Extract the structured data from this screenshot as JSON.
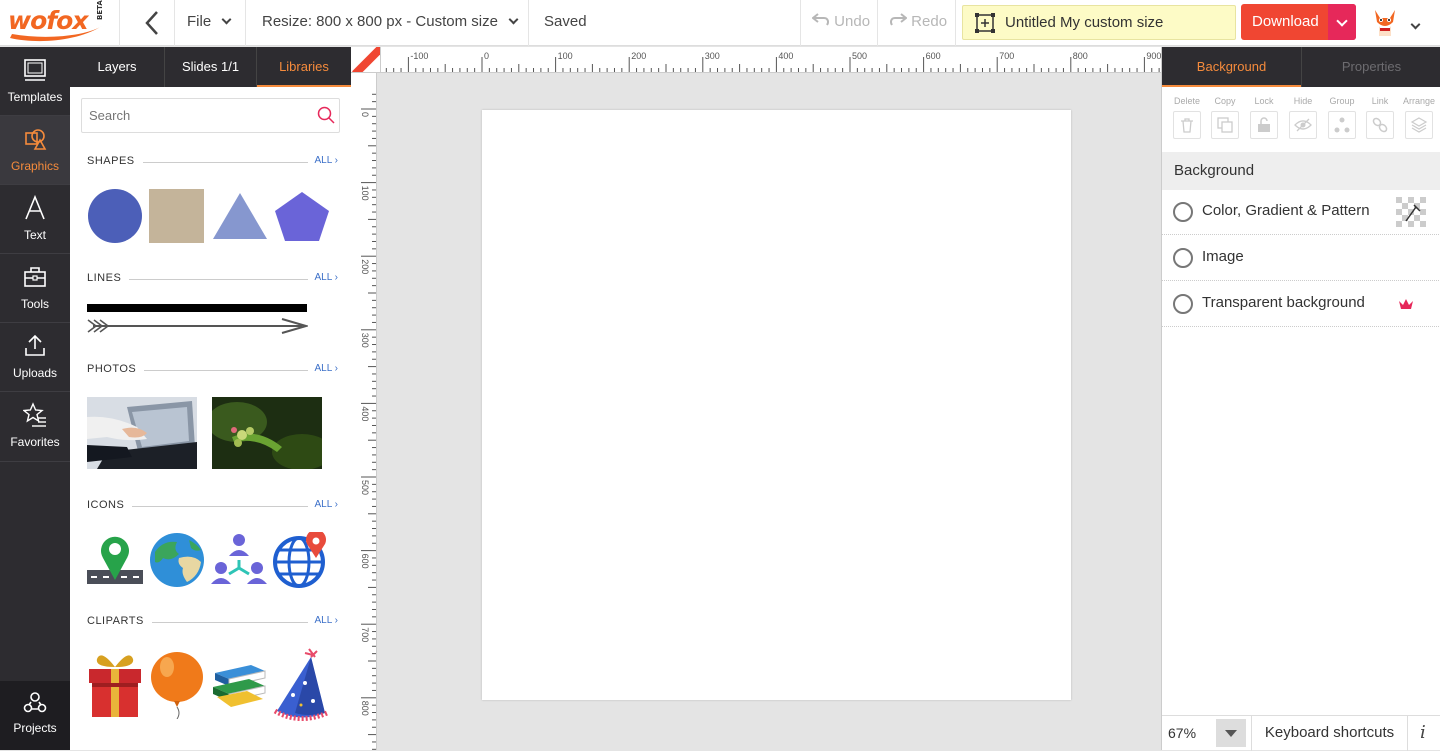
{
  "app": {
    "logo_text": "wofox",
    "logo_badge": "BETA"
  },
  "topbar": {
    "file_menu": "File",
    "resize_label": "Resize: 800 x 800 px - Custom size",
    "save_status": "Saved",
    "undo_label": "Undo",
    "redo_label": "Redo",
    "document_title": "Untitled My custom size",
    "download_label": "Download"
  },
  "leftnav": {
    "items": [
      {
        "label": "Templates",
        "icon": "templates-icon"
      },
      {
        "label": "Graphics",
        "icon": "graphics-icon",
        "active": true
      },
      {
        "label": "Text",
        "icon": "text-icon"
      },
      {
        "label": "Tools",
        "icon": "tools-icon"
      },
      {
        "label": "Uploads",
        "icon": "uploads-icon"
      },
      {
        "label": "Favorites",
        "icon": "favorites-icon"
      }
    ],
    "projects_label": "Projects"
  },
  "panel": {
    "tabs": [
      "Layers",
      "Slides 1/1",
      "Libraries"
    ],
    "active_tab": "Libraries",
    "search_placeholder": "Search",
    "sections": {
      "shapes": {
        "title": "SHAPES",
        "all": "ALL"
      },
      "lines": {
        "title": "LINES",
        "all": "ALL"
      },
      "photos": {
        "title": "PHOTOS",
        "all": "ALL"
      },
      "icons": {
        "title": "ICONS",
        "all": "ALL"
      },
      "cliparts": {
        "title": "CLIPARTS",
        "all": "ALL"
      }
    },
    "shape_colors": {
      "circle": "#4c5fb8",
      "square": "#c4b49a",
      "triangle": "#8697cf",
      "pentagon": "#6a64d8"
    }
  },
  "rulers": {
    "horizontal_labels": [
      "-100",
      "0",
      "100",
      "200",
      "300",
      "400",
      "500",
      "600",
      "700",
      "800",
      "900"
    ],
    "vertical_labels": [
      "0",
      "100",
      "200",
      "300",
      "400",
      "500",
      "600",
      "700",
      "800"
    ]
  },
  "rpanel": {
    "tabs": [
      "Background",
      "Properties"
    ],
    "active_tab": "Background",
    "tools": [
      "Delete",
      "Copy",
      "Lock",
      "Hide",
      "Group",
      "Link",
      "Arrange"
    ],
    "section_title": "Background",
    "options": [
      "Color, Gradient & Pattern",
      "Image",
      "Transparent background"
    ],
    "zoom": "67%",
    "shortcuts_label": "Keyboard shortcuts",
    "info_label": "i"
  },
  "colors": {
    "accent": "#f58b3c",
    "download": "#f04632",
    "download_dd": "#e6285a",
    "sidebar": "#2d2c30",
    "title_bg": "#fdfbc6"
  }
}
